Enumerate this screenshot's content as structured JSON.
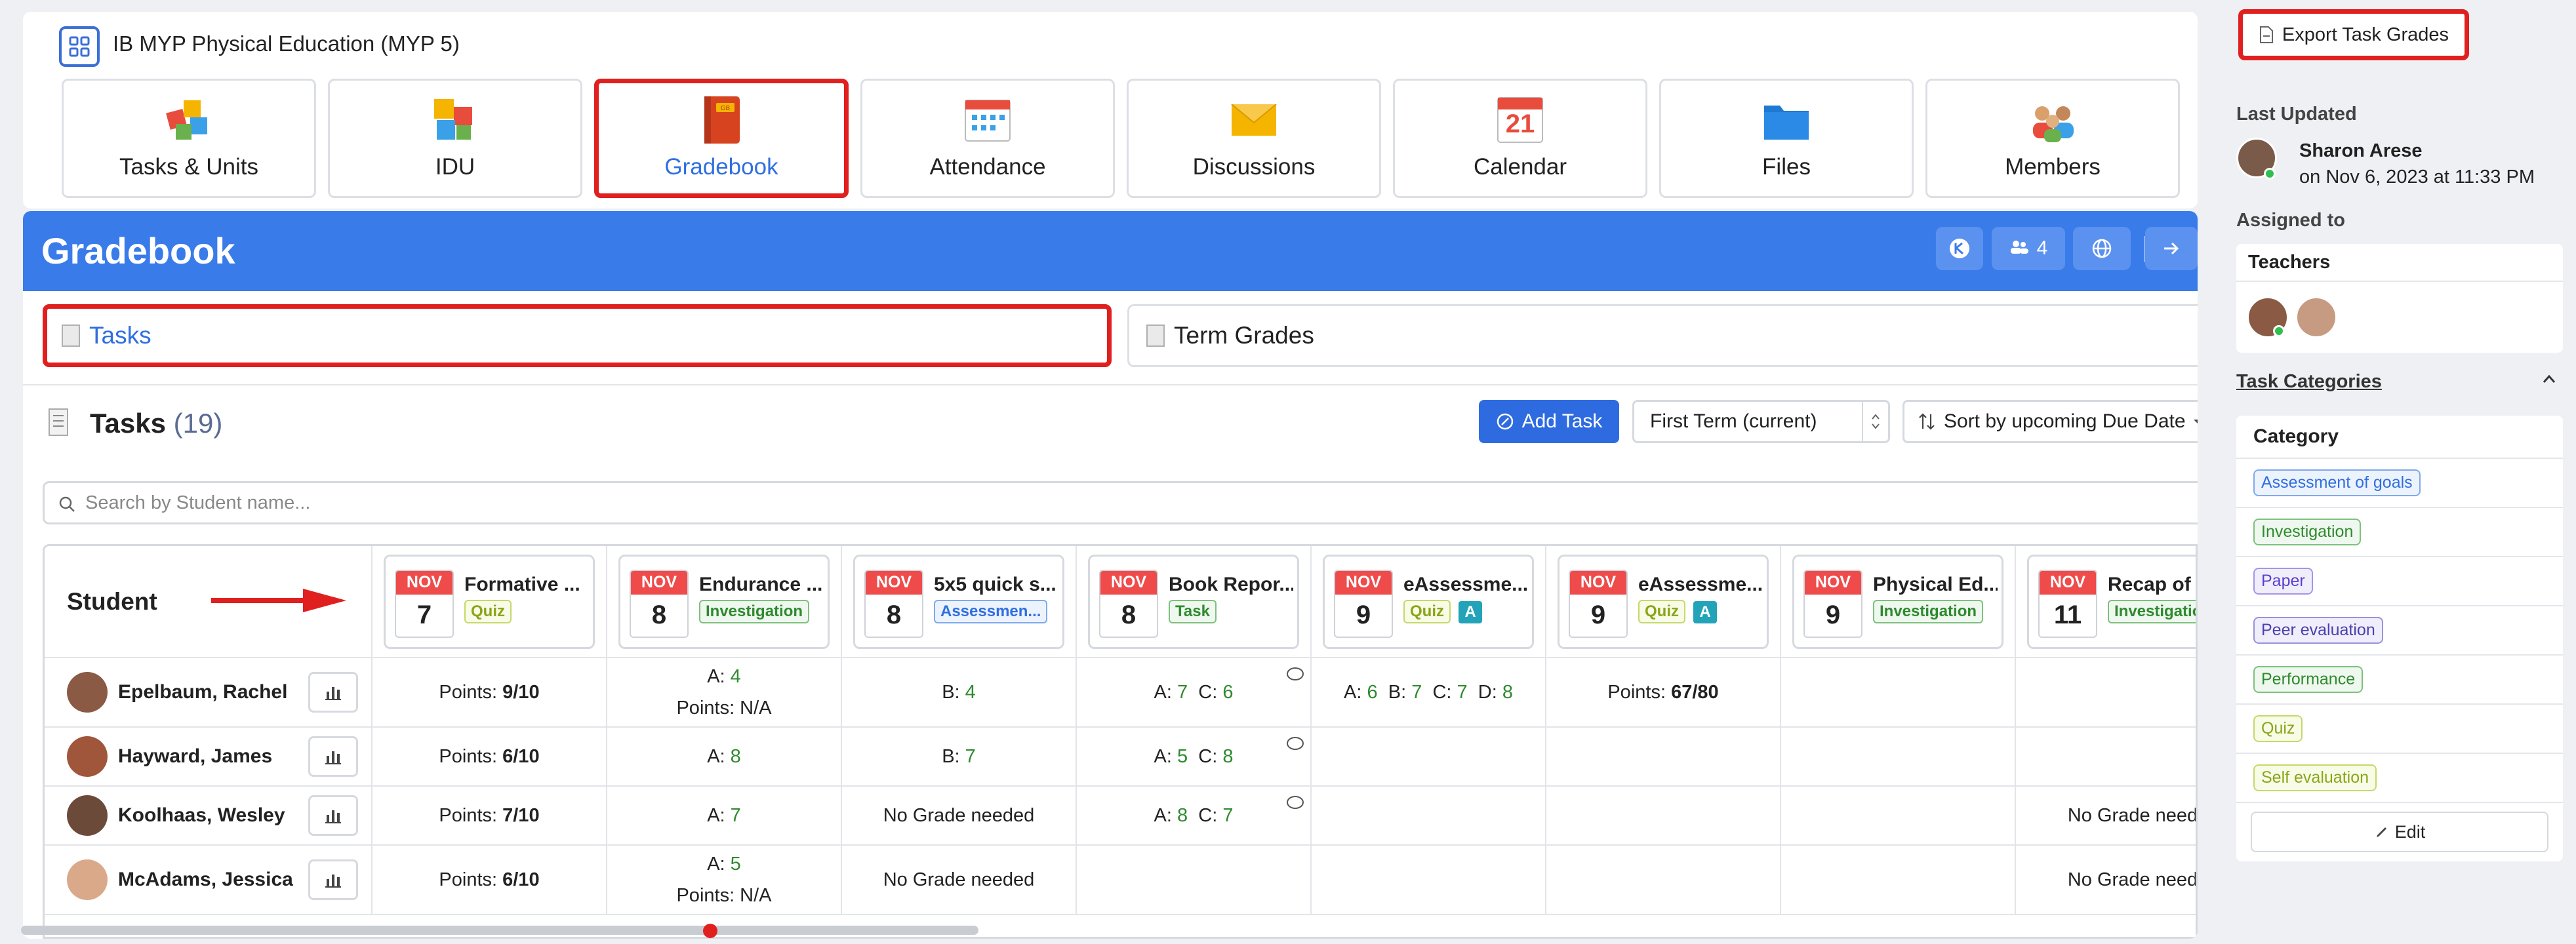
{
  "course": {
    "title": "IB MYP Physical Education (MYP 5)"
  },
  "nav": [
    {
      "label": "Tasks & Units",
      "icon": "puzzle-icon"
    },
    {
      "label": "IDU",
      "icon": "puzzle-blocks-icon"
    },
    {
      "label": "Gradebook",
      "icon": "gradebook-book-icon"
    },
    {
      "label": "Attendance",
      "icon": "attendance-calendar-icon"
    },
    {
      "label": "Discussions",
      "icon": "envelope-icon"
    },
    {
      "label": "Calendar",
      "icon": "calendar-icon",
      "day": "21"
    },
    {
      "label": "Files",
      "icon": "folder-icon"
    },
    {
      "label": "Members",
      "icon": "members-icon"
    }
  ],
  "gradebook": {
    "title": "Gradebook",
    "members_count": "4",
    "tabs": {
      "tasks": "Tasks",
      "term_grades": "Term Grades"
    },
    "tasks_heading": "Tasks",
    "tasks_count": "(19)",
    "add_task": "Add Task",
    "term_select": "First Term (current)",
    "sort_select": "Sort by upcoming Due Date",
    "search_placeholder": "Search by Student name...",
    "student_header": "Student"
  },
  "tasks": [
    {
      "month": "NOV",
      "day": "7",
      "name": "Formative ...",
      "category": "Quiz",
      "cat_class": "cat-quiz",
      "badge": ""
    },
    {
      "month": "NOV",
      "day": "8",
      "name": "Endurance ...",
      "category": "Investigation",
      "cat_class": "cat-inv",
      "badge": ""
    },
    {
      "month": "NOV",
      "day": "8",
      "name": "5x5 quick s...",
      "category": "Assessmen...",
      "cat_class": "cat-ass",
      "badge": ""
    },
    {
      "month": "NOV",
      "day": "8",
      "name": "Book Repor...",
      "category": "Task",
      "cat_class": "cat-task",
      "badge": ""
    },
    {
      "month": "NOV",
      "day": "9",
      "name": "eAssessme...",
      "category": "Quiz",
      "cat_class": "cat-quiz",
      "badge": "A"
    },
    {
      "month": "NOV",
      "day": "9",
      "name": "eAssessme...",
      "category": "Quiz",
      "cat_class": "cat-quiz",
      "badge": "A"
    },
    {
      "month": "NOV",
      "day": "9",
      "name": "Physical Ed...",
      "category": "Investigation",
      "cat_class": "cat-inv",
      "badge": ""
    },
    {
      "month": "NOV",
      "day": "11",
      "name": "Recap of",
      "category": "Investigation",
      "cat_class": "cat-inv",
      "badge": ""
    }
  ],
  "students": [
    {
      "name": "Epelbaum, Rachel",
      "avatar_color": "#8a5a44",
      "cells": [
        {
          "parts": [
            {
              "t": "Points: "
            },
            {
              "t": "9/10",
              "b": true
            }
          ]
        },
        {
          "lines": [
            [
              {
                "t": "A: "
              },
              {
                "t": "4",
                "g": true
              }
            ],
            [
              {
                "t": "Points: N/A"
              }
            ]
          ]
        },
        {
          "parts": [
            {
              "t": "B: "
            },
            {
              "t": "4",
              "g": true
            }
          ]
        },
        {
          "parts": [
            {
              "t": "A: "
            },
            {
              "t": "7",
              "g": true
            },
            {
              "t": "  C: "
            },
            {
              "t": "6",
              "g": true
            }
          ],
          "comment": true
        },
        {
          "parts": [
            {
              "t": "A: "
            },
            {
              "t": "6",
              "g": true
            },
            {
              "t": "  B: "
            },
            {
              "t": "7",
              "g": true
            },
            {
              "t": "  C: "
            },
            {
              "t": "7",
              "g": true
            },
            {
              "t": "  D: "
            },
            {
              "t": "8",
              "g": true
            }
          ]
        },
        {
          "parts": [
            {
              "t": "Points: "
            },
            {
              "t": "67/80",
              "b": true
            }
          ]
        },
        {
          "parts": []
        },
        {
          "parts": []
        }
      ]
    },
    {
      "name": "Hayward, James",
      "avatar_color": "#a0563a",
      "cells": [
        {
          "parts": [
            {
              "t": "Points: "
            },
            {
              "t": "6/10",
              "b": true
            }
          ]
        },
        {
          "parts": [
            {
              "t": "A: "
            },
            {
              "t": "8",
              "g": true
            }
          ]
        },
        {
          "parts": [
            {
              "t": "B: "
            },
            {
              "t": "7",
              "g": true
            }
          ]
        },
        {
          "parts": [
            {
              "t": "A: "
            },
            {
              "t": "5",
              "g": true
            },
            {
              "t": "  C: "
            },
            {
              "t": "8",
              "g": true
            }
          ],
          "comment": true
        },
        {
          "parts": []
        },
        {
          "parts": []
        },
        {
          "parts": []
        },
        {
          "parts": []
        }
      ]
    },
    {
      "name": "Koolhaas, Wesley",
      "avatar_color": "#6b4a3a",
      "cells": [
        {
          "parts": [
            {
              "t": "Points: "
            },
            {
              "t": "7/10",
              "b": true
            }
          ]
        },
        {
          "parts": [
            {
              "t": "A: "
            },
            {
              "t": "7",
              "g": true
            }
          ]
        },
        {
          "parts": [
            {
              "t": "No Grade needed"
            }
          ]
        },
        {
          "parts": [
            {
              "t": "A: "
            },
            {
              "t": "8",
              "g": true
            },
            {
              "t": "  C: "
            },
            {
              "t": "7",
              "g": true
            }
          ],
          "comment": true
        },
        {
          "parts": []
        },
        {
          "parts": []
        },
        {
          "parts": []
        },
        {
          "parts": [
            {
              "t": "No Grade need"
            }
          ]
        }
      ]
    },
    {
      "name": "McAdams, Jessica",
      "avatar_color": "#d9a98a",
      "cells": [
        {
          "parts": [
            {
              "t": "Points: "
            },
            {
              "t": "6/10",
              "b": true
            }
          ]
        },
        {
          "lines": [
            [
              {
                "t": "A: "
              },
              {
                "t": "5",
                "g": true
              }
            ],
            [
              {
                "t": "Points: N/A"
              }
            ]
          ]
        },
        {
          "parts": [
            {
              "t": "No Grade needed"
            }
          ]
        },
        {
          "parts": []
        },
        {
          "parts": []
        },
        {
          "parts": []
        },
        {
          "parts": []
        },
        {
          "parts": [
            {
              "t": "No Grade need"
            }
          ]
        }
      ]
    }
  ],
  "sidebar": {
    "export_label": "Export Task Grades",
    "last_updated_label": "Last Updated",
    "updater_name": "Sharon Arese",
    "updated_on": "on Nov 6, 2023 at 11:33 PM",
    "assigned_label": "Assigned to",
    "teachers_label": "Teachers",
    "task_categories_label": "Task Categories",
    "category_header": "Category",
    "categories": [
      {
        "label": "Assessment of goals",
        "color": "#2f6fe0",
        "bg": "#edf3fd",
        "border": "#7ea9ef"
      },
      {
        "label": "Investigation",
        "color": "#2f8a2f",
        "bg": "#eef8ee",
        "border": "#7ec07e"
      },
      {
        "label": "Paper",
        "color": "#5b3fd1",
        "bg": "#f1eefc",
        "border": "#a595ea"
      },
      {
        "label": "Peer evaluation",
        "color": "#4b3fb0",
        "bg": "#efeefa",
        "border": "#9a92dc"
      },
      {
        "label": "Performance",
        "color": "#2f8a2f",
        "bg": "#eef8ee",
        "border": "#7ec07e"
      },
      {
        "label": "Quiz",
        "color": "#8aa51a",
        "bg": "#f8fbe6",
        "border": "#c6d86b"
      },
      {
        "label": "Self evaluation",
        "color": "#8aa51a",
        "bg": "#f8fbe6",
        "border": "#c6d86b"
      }
    ],
    "edit_label": "Edit"
  },
  "colors": {
    "primary": "#3a7bea",
    "highlight": "#e0201f",
    "accent_green": "#2f8a2f"
  }
}
